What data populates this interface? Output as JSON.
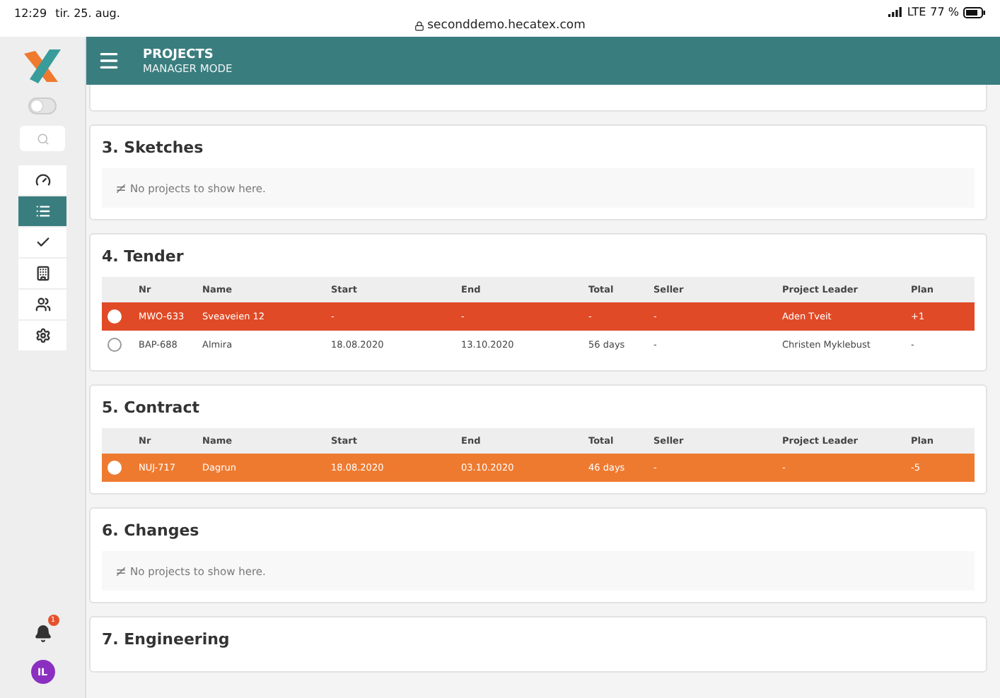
{
  "status_bar": {
    "time": "12:29",
    "date": "tir. 25. aug.",
    "url": "seconddemo.hecatex.com",
    "network": "LTE",
    "battery": "77 %"
  },
  "header": {
    "title": "PROJECTS",
    "subtitle": "MANAGER MODE"
  },
  "sidebar": {
    "toggle_on": false,
    "nav": [
      {
        "selected": false
      },
      {
        "selected": true
      },
      {
        "selected": false
      },
      {
        "selected": false
      },
      {
        "selected": false
      },
      {
        "selected": false
      }
    ],
    "notifications": "1",
    "avatar": "IL"
  },
  "sections": [
    {
      "title": "3. Sketches",
      "empty": "No projects to show here."
    },
    {
      "title": "4. Tender",
      "columns": [
        "Nr",
        "Name",
        "Start",
        "End",
        "Total",
        "Seller",
        "Project Leader",
        "Plan"
      ],
      "rows": [
        {
          "selected": false,
          "color": "#e04a26",
          "cells": [
            "MWO-633",
            "Sveaveien 12",
            "-",
            "-",
            "-",
            "-",
            "Aden Tveit",
            "+1"
          ]
        },
        {
          "selected": false,
          "cells": [
            "BAP-688",
            "Almira",
            "18.08.2020",
            "13.10.2020",
            "56 days",
            "-",
            "Christen Myklebust",
            "-"
          ]
        }
      ]
    },
    {
      "title": "5. Contract",
      "columns": [
        "Nr",
        "Name",
        "Start",
        "End",
        "Total",
        "Seller",
        "Project Leader",
        "Plan"
      ],
      "rows": [
        {
          "selected": false,
          "color": "#ee7a30",
          "cells": [
            "NUJ-717",
            "Dagrun",
            "18.08.2020",
            "03.10.2020",
            "46 days",
            "-",
            "-",
            "-5"
          ]
        }
      ]
    },
    {
      "title": "6. Changes",
      "empty": "No projects to show here."
    },
    {
      "title": "7. Engineering"
    }
  ]
}
